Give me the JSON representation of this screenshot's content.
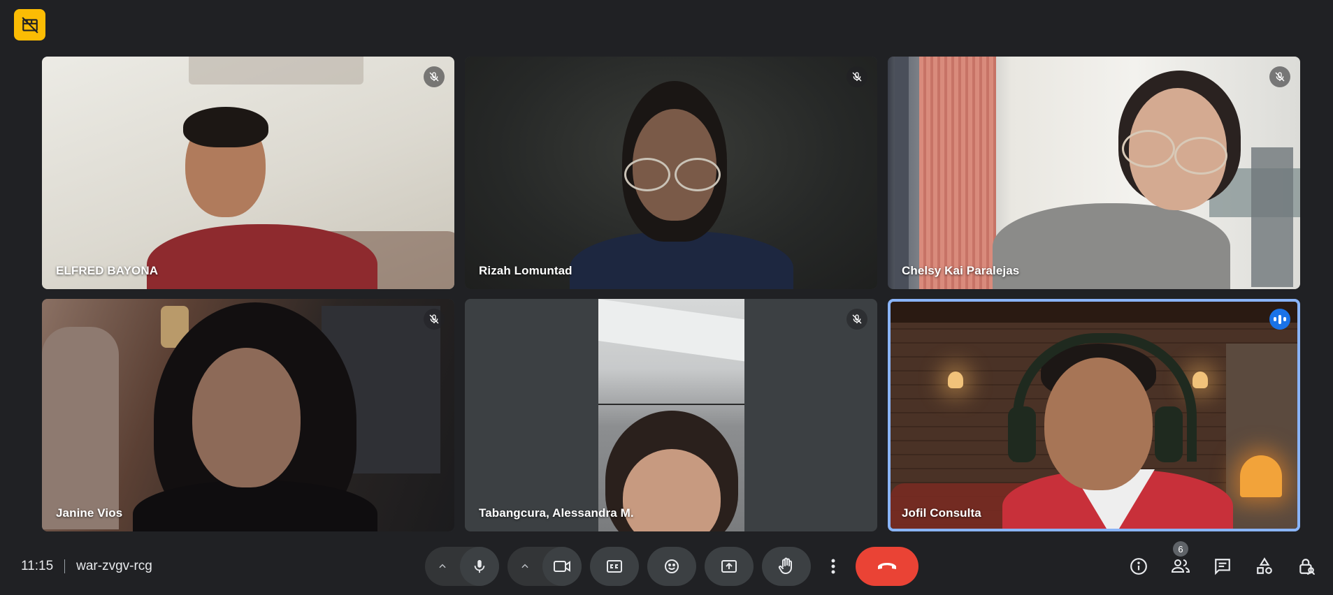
{
  "meeting": {
    "time": "11:15",
    "code": "war-zvgv-rcg",
    "participant_count": "6"
  },
  "participants": [
    {
      "name": "ELFRED BAYONA",
      "muted": true
    },
    {
      "name": "Rizah Lomuntad",
      "muted": true
    },
    {
      "name": "Chelsy Kai Paralejas",
      "muted": true
    },
    {
      "name": "Janine Vios",
      "muted": true
    },
    {
      "name": "Tabangcura, Alessandra M.",
      "muted": true
    },
    {
      "name": "Jofil Consulta",
      "muted": false,
      "speaking": true
    }
  ],
  "controls": [
    "audio-options-caret",
    "microphone",
    "video-options-caret",
    "camera",
    "captions",
    "emoji-reactions",
    "present-screen",
    "raise-hand",
    "more-options",
    "end-call"
  ],
  "side_controls": [
    "meeting-details",
    "people",
    "chat",
    "activities",
    "host-controls"
  ],
  "colors": {
    "background": "#202124",
    "badge": "#fbbc04",
    "end_call": "#ea4335",
    "active_border": "#8ab4f8",
    "speaking": "#1a73e8"
  }
}
